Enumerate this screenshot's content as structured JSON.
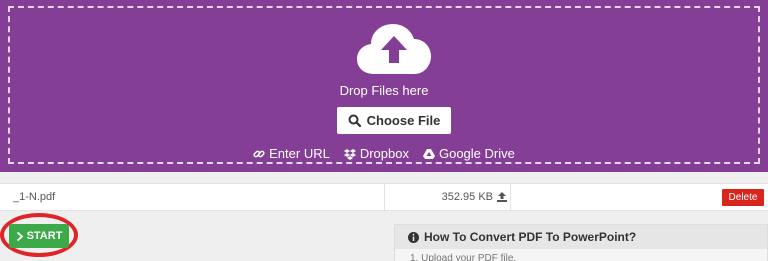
{
  "upload": {
    "drop_text": "Drop Files here",
    "choose_label": "Choose File",
    "sources": [
      {
        "label": "Enter URL",
        "icon": "link-icon"
      },
      {
        "label": "Dropbox",
        "icon": "dropbox-icon"
      },
      {
        "label": "Google Drive",
        "icon": "google-drive-icon"
      }
    ],
    "colors": {
      "background": "#843e95",
      "border": "#e6d6ea"
    }
  },
  "files": [
    {
      "name": "_1-N.pdf",
      "size": "352.95 KB",
      "delete_label": "Delete"
    }
  ],
  "actions": {
    "start_label": "START",
    "start_color": "#3daa4a"
  },
  "howto": {
    "title": "How To Convert PDF To PowerPoint?",
    "step_1": "1. Upload your PDF file."
  }
}
